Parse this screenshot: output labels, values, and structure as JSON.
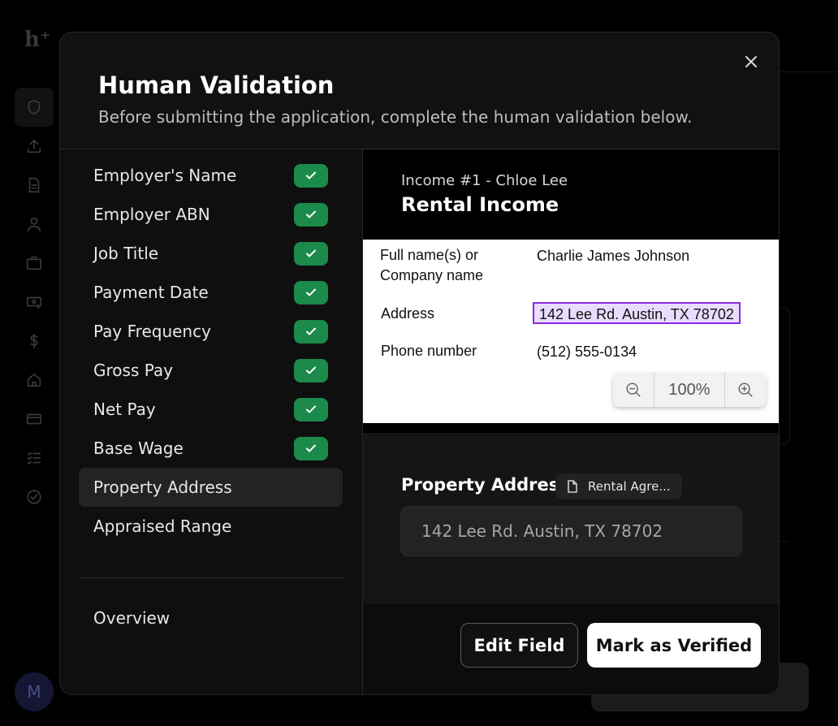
{
  "background": {
    "logo": "h⁺",
    "avatar_initial": "M",
    "rail_icons": [
      "shield-icon",
      "upload-icon",
      "document-icon",
      "user-icon",
      "briefcase-icon",
      "money-transfer-icon",
      "dollar-icon",
      "home-icon",
      "credit-card-icon",
      "checklist-icon",
      "check-circle-icon"
    ]
  },
  "modal": {
    "title": "Human Validation",
    "subtitle": "Before submitting the application, complete the human validation below.",
    "close_icon": "close-icon"
  },
  "fields": [
    {
      "label": "Employer's Name",
      "verified": true
    },
    {
      "label": "Employer ABN",
      "verified": true
    },
    {
      "label": "Job Title",
      "verified": true
    },
    {
      "label": "Payment Date",
      "verified": true
    },
    {
      "label": "Pay Frequency",
      "verified": true
    },
    {
      "label": "Gross Pay",
      "verified": true
    },
    {
      "label": "Net Pay",
      "verified": true
    },
    {
      "label": "Base Wage",
      "verified": true
    },
    {
      "label": "Property Address",
      "verified": false,
      "selected": true
    },
    {
      "label": "Appraised Range",
      "verified": false
    }
  ],
  "overview_label": "Overview",
  "income": {
    "subheading": "Income #1 - Chloe Lee",
    "title": "Rental Income"
  },
  "document": {
    "name_label_line1": "Full name(s) or",
    "name_label_line2": "Company name",
    "name_value": "Charlie James Johnson",
    "address_label": "Address",
    "address_value": "142 Lee Rd. Austin, TX 78702",
    "phone_label": "Phone number",
    "phone_value": "(512) 555-0134",
    "zoom": "100%"
  },
  "property": {
    "label": "Property Address",
    "source_chip": "Rental Agre...",
    "value": "142 Lee Rd. Austin, TX 78702"
  },
  "actions": {
    "edit": "Edit Field",
    "verify": "Mark as Verified"
  },
  "colors": {
    "verified_badge": "#1b8a4b",
    "highlight_border": "#8a2be2",
    "highlight_fill": "#eadcff"
  }
}
